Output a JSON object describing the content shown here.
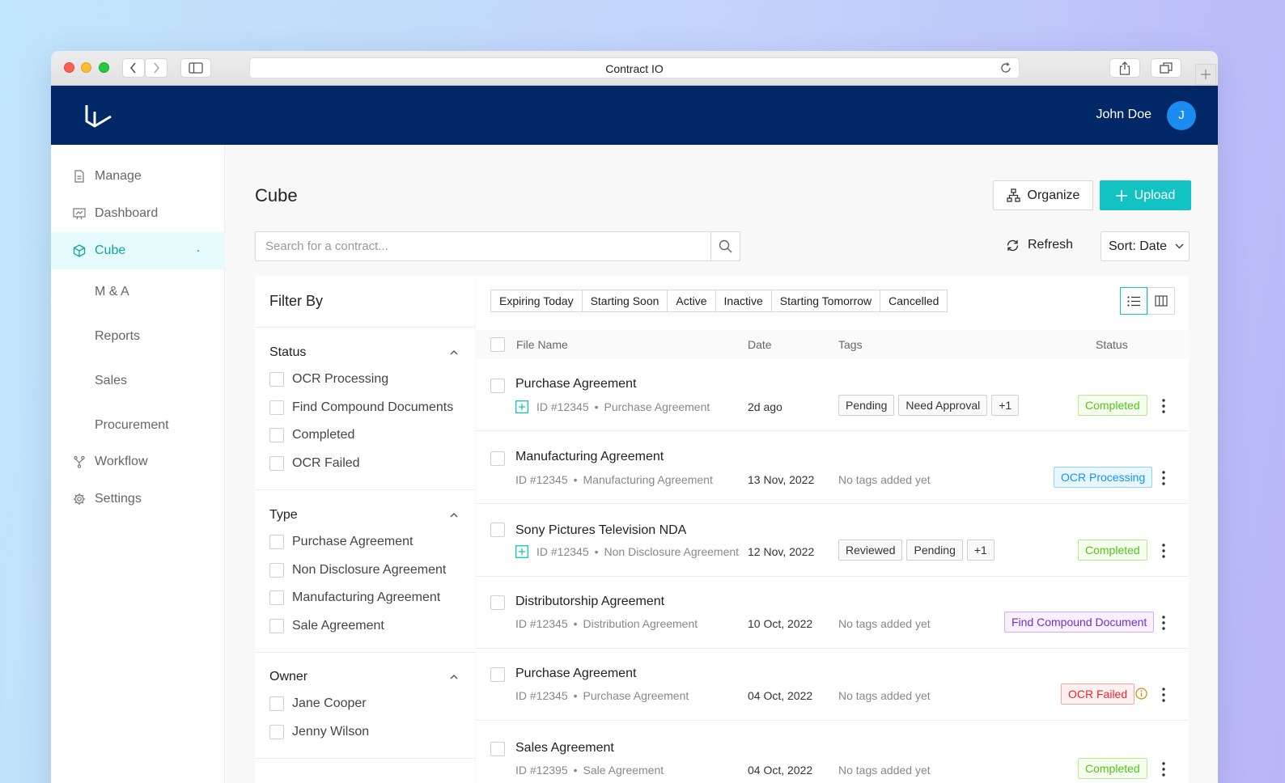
{
  "browser": {
    "title": "Contract IO"
  },
  "user": {
    "name": "John Doe",
    "initial": "J"
  },
  "sidebar": {
    "items": [
      {
        "label": "Manage",
        "icon": "document-icon"
      },
      {
        "label": "Dashboard",
        "icon": "presentation-chart-icon"
      },
      {
        "label": "Cube",
        "icon": "cube-icon",
        "active": true
      },
      {
        "label": "M & A"
      },
      {
        "label": "Reports"
      },
      {
        "label": "Sales"
      },
      {
        "label": "Procurement"
      },
      {
        "label": "Workflow",
        "icon": "workflow-icon"
      },
      {
        "label": "Settings",
        "icon": "gear-icon"
      }
    ]
  },
  "header": {
    "title": "Cube",
    "organize_label": "Organize",
    "upload_label": "Upload",
    "search_placeholder": "Search for a contract...",
    "refresh_label": "Refresh",
    "sort_label": "Sort: Date"
  },
  "filters": {
    "title": "Filter By",
    "groups": [
      {
        "title": "Status",
        "options": [
          "OCR Processing",
          "Find Compound Documents",
          "Completed",
          "OCR Failed"
        ]
      },
      {
        "title": "Type",
        "options": [
          "Purchase Agreement",
          "Non Disclosure Agreement",
          "Manufacturing Agreement",
          "Sale Agreement"
        ]
      },
      {
        "title": "Owner",
        "options": [
          "Jane Cooper",
          "Jenny Wilson"
        ]
      }
    ]
  },
  "quick_filters": [
    "Expiring Today",
    "Starting Soon",
    "Active",
    "Inactive",
    "Starting Tomorrow",
    "Cancelled"
  ],
  "table": {
    "columns": {
      "file_name": "File Name",
      "date": "Date",
      "tags": "Tags",
      "status": "Status"
    },
    "separator": "•",
    "no_tags": "No tags added yet",
    "rows": [
      {
        "name": "Purchase Agreement",
        "id": "ID #12345",
        "type": "Purchase Agreement",
        "date": "2d ago",
        "tags": [
          "Pending",
          "Need Approval",
          "+1"
        ],
        "status": "Completed",
        "compound": true
      },
      {
        "name": "Manufacturing Agreement",
        "id": "ID #12345",
        "type": "Manufacturing Agreement",
        "date": "13 Nov, 2022",
        "tags": [],
        "status": "OCR Processing"
      },
      {
        "name": "Sony Pictures Television NDA",
        "id": "ID #12345",
        "type": "Non Disclosure Agreement",
        "date": "12 Nov, 2022",
        "tags": [
          "Reviewed",
          "Pending",
          "+1"
        ],
        "status": "Completed",
        "compound": true
      },
      {
        "name": "Distributorship Agreement",
        "id": "ID #12345",
        "type": "Distribution Agreement",
        "date": "10 Oct, 2022",
        "tags": [],
        "status": "Find Compound Document"
      },
      {
        "name": "Purchase Agreement",
        "id": "ID #12345",
        "type": "Purchase Agreement",
        "date": "04 Oct, 2022",
        "tags": [],
        "status": "OCR Failed"
      },
      {
        "name": "Sales Agreement",
        "id": "ID #12395",
        "type": "Sale Agreement",
        "date": "04 Oct, 2022",
        "tags": [],
        "status": "Completed"
      }
    ]
  },
  "colors": {
    "topbar": "#002766",
    "accent": "#13c2c2",
    "avatar": "#1a8cf0"
  }
}
